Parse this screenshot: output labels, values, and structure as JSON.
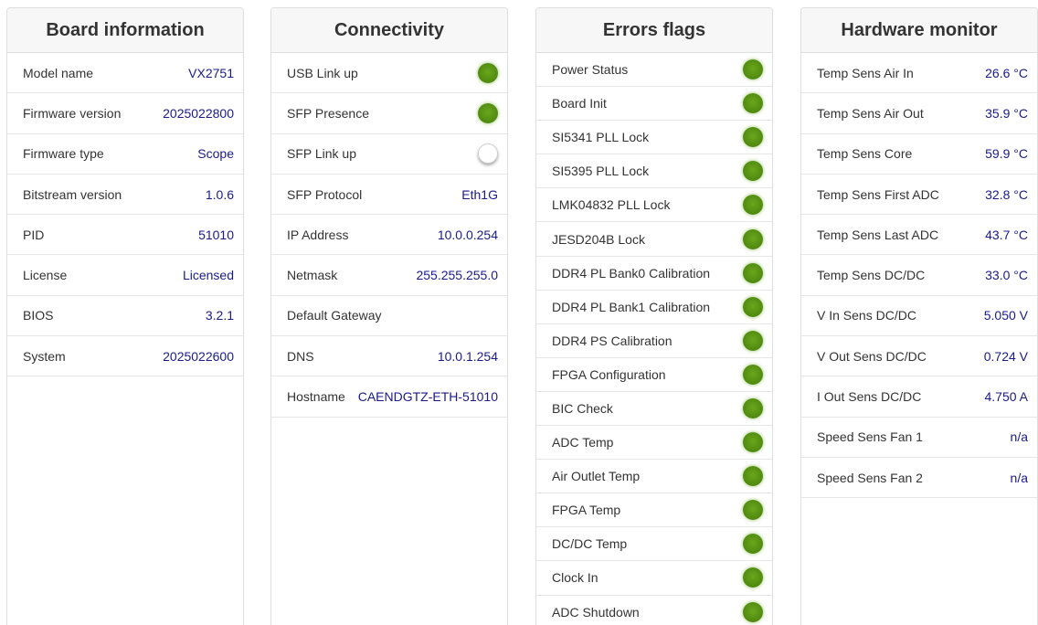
{
  "board": {
    "title": "Board information",
    "rows": [
      {
        "label": "Model name",
        "value": "VX2751"
      },
      {
        "label": "Firmware version",
        "value": "2025022800"
      },
      {
        "label": "Firmware type",
        "value": "Scope"
      },
      {
        "label": "Bitstream version",
        "value": "1.0.6"
      },
      {
        "label": "PID",
        "value": "51010"
      },
      {
        "label": "License",
        "value": "Licensed"
      },
      {
        "label": "BIOS",
        "value": "3.2.1"
      },
      {
        "label": "System",
        "value": "2025022600"
      }
    ]
  },
  "connectivity": {
    "title": "Connectivity",
    "rows": [
      {
        "label": "USB Link up",
        "status": "on"
      },
      {
        "label": "SFP Presence",
        "status": "on"
      },
      {
        "label": "SFP Link up",
        "status": "off"
      },
      {
        "label": "SFP Protocol",
        "value": "Eth1G"
      },
      {
        "label": "IP Address",
        "value": "10.0.0.254"
      },
      {
        "label": "Netmask",
        "value": "255.255.255.0"
      },
      {
        "label": "Default Gateway",
        "value": ""
      },
      {
        "label": "DNS",
        "value": "10.0.1.254"
      },
      {
        "label": "Hostname",
        "value": "CAENDGTZ-ETH-51010"
      }
    ]
  },
  "errors": {
    "title": "Errors flags",
    "rows": [
      {
        "label": "Power Status",
        "status": "on"
      },
      {
        "label": "Board Init",
        "status": "on"
      },
      {
        "label": "SI5341 PLL Lock",
        "status": "on"
      },
      {
        "label": "SI5395 PLL Lock",
        "status": "on"
      },
      {
        "label": "LMK04832 PLL Lock",
        "status": "on"
      },
      {
        "label": "JESD204B Lock",
        "status": "on"
      },
      {
        "label": "DDR4 PL Bank0 Calibration",
        "status": "on"
      },
      {
        "label": "DDR4 PL Bank1 Calibration",
        "status": "on"
      },
      {
        "label": "DDR4 PS Calibration",
        "status": "on"
      },
      {
        "label": "FPGA Configuration",
        "status": "on"
      },
      {
        "label": "BIC Check",
        "status": "on"
      },
      {
        "label": "ADC Temp",
        "status": "on"
      },
      {
        "label": "Air Outlet Temp",
        "status": "on"
      },
      {
        "label": "FPGA Temp",
        "status": "on"
      },
      {
        "label": "DC/DC Temp",
        "status": "on"
      },
      {
        "label": "Clock In",
        "status": "on"
      },
      {
        "label": "ADC Shutdown",
        "status": "on"
      }
    ]
  },
  "hardware": {
    "title": "Hardware monitor",
    "rows": [
      {
        "label": "Temp Sens Air In",
        "value": "26.6 °C"
      },
      {
        "label": "Temp Sens Air Out",
        "value": "35.9 °C"
      },
      {
        "label": "Temp Sens Core",
        "value": "59.9 °C"
      },
      {
        "label": "Temp Sens First ADC",
        "value": "32.8 °C"
      },
      {
        "label": "Temp Sens Last ADC",
        "value": "43.7 °C"
      },
      {
        "label": "Temp Sens DC/DC",
        "value": "33.0 °C"
      },
      {
        "label": "V In Sens DC/DC",
        "value": "5.050 V"
      },
      {
        "label": "V Out Sens DC/DC",
        "value": "0.724 V"
      },
      {
        "label": "I Out Sens DC/DC",
        "value": "4.750 A"
      },
      {
        "label": "Speed Sens Fan 1",
        "value": "n/a"
      },
      {
        "label": "Speed Sens Fan 2",
        "value": "n/a"
      }
    ]
  },
  "colors": {
    "led_on": "#4f8a10",
    "led_off": "#ffffff",
    "value_text": "#1a1a8c",
    "header_bg": "#f7f7f7"
  }
}
